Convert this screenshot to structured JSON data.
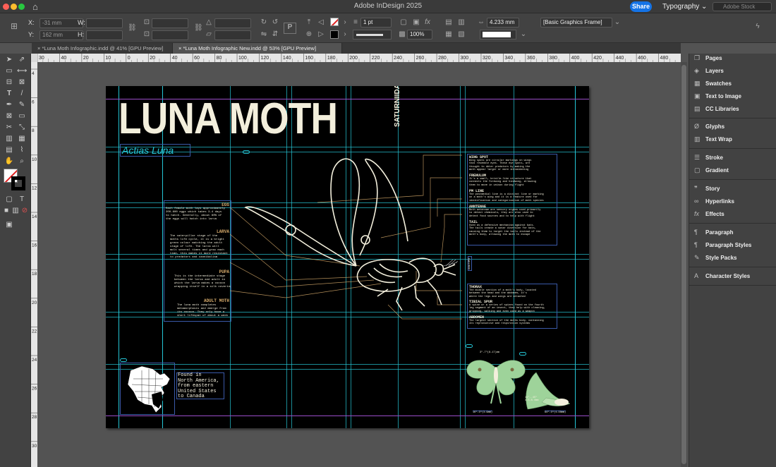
{
  "app": {
    "title": "Adobe InDesign 2025",
    "share_label": "Share",
    "workspace_label": "Typography",
    "stock_placeholder": "Adobe Stock"
  },
  "control_bar": {
    "x_label": "X:",
    "x_value": "-31 mm",
    "y_label": "Y:",
    "y_value": "162 mm",
    "w_label": "W:",
    "h_label": "H:",
    "stroke_weight": "1 pt",
    "opacity": "100%",
    "dimension": "4.233 mm",
    "object_style": "[Basic Graphics Frame]"
  },
  "tabs": [
    {
      "label": "*Luna Moth Infographic.indd @ 41% [GPU Preview]",
      "active": false
    },
    {
      "label": "*Luna Moth Infographic New.indd @ 53% [GPU Preview]",
      "active": true
    }
  ],
  "ruler": {
    "h_ticks": [
      "30",
      "40",
      "20",
      "10",
      "0",
      "20",
      "40",
      "60",
      "80",
      "100",
      "120",
      "140",
      "160",
      "180",
      "200",
      "220",
      "240",
      "260",
      "280",
      "300",
      "320",
      "340",
      "360",
      "380",
      "400",
      "420",
      "440",
      "460",
      "480"
    ],
    "v_ticks": [
      "4",
      "6",
      "8",
      "10",
      "12",
      "14",
      "16",
      "18",
      "20",
      "22",
      "24",
      "26",
      "28",
      "30"
    ]
  },
  "panels": [
    {
      "label": "Pages",
      "icon": "pages-icon"
    },
    {
      "label": "Layers",
      "icon": "layers-icon"
    },
    {
      "label": "Swatches",
      "icon": "swatches-icon"
    },
    {
      "label": "Text to Image",
      "icon": "text-to-image-icon"
    },
    {
      "label": "CC Libraries",
      "icon": "cc-libraries-icon"
    },
    {
      "label": "Glyphs",
      "icon": "glyphs-icon"
    },
    {
      "label": "Text Wrap",
      "icon": "text-wrap-icon"
    },
    {
      "label": "Stroke",
      "icon": "stroke-icon"
    },
    {
      "label": "Gradient",
      "icon": "gradient-icon"
    },
    {
      "label": "Story",
      "icon": "story-icon"
    },
    {
      "label": "Hyperlinks",
      "icon": "hyperlinks-icon"
    },
    {
      "label": "Effects",
      "icon": "effects-icon"
    },
    {
      "label": "Paragraph",
      "icon": "paragraph-icon"
    },
    {
      "label": "Paragraph Styles",
      "icon": "paragraph-styles-icon"
    },
    {
      "label": "Style Packs",
      "icon": "style-packs-icon"
    },
    {
      "label": "Character Styles",
      "icon": "character-styles-icon"
    }
  ],
  "document": {
    "title": "LUNA MOTH",
    "family": "SATURNIIDAE",
    "subtitle": "Actias Luna",
    "left_sections": [
      {
        "heading": "EGG",
        "body": "Each female moth lays approximately\n200-600 eggs which takes 3-4 days\nto hatch. Generally, about 80% of\nthe eggs will hatch into larva"
      },
      {
        "heading": "LARVA",
        "body": "The caterpillar stage of the\nmoths life cycle, it is a bright\ngreen colour matching the adult\nstage of life. The larva will\nmolt several times and grow each\ntime, this makes it more resistant\nto predators and cannibalism"
      },
      {
        "heading": "PUPA",
        "body": "This is the intermediate stage\nbetween the larva and adult in\nwhich the larva makes a cocoon\nwrapping itself in a silk covering"
      },
      {
        "heading": "ADULT MOTH",
        "body": "The luna moth completes\nmetamorphosis and emerge from\nits cocoon. They only have a\nshort lifespan of about a week"
      }
    ],
    "right_top_sections": [
      {
        "heading": "WING SPOT",
        "body": "Wing spots are circular markings on wings\nthat resemble eyes. These eye spots, are\nthought to deter predators by making the\nmoth appear larger or more intimidating"
      },
      {
        "heading": "FRENULUM",
        "body": "It's a small, bristle-like structure that\nconnects the forewing and hindwing, allowing\nthem to move in unison during flight"
      },
      {
        "heading": "PM LINE",
        "body": "The postmedial line is a distinct line or marking\non a moth's wing and it is a feature used for\nidentification and categorization of moth species"
      },
      {
        "heading": "ANNTENAE",
        "body": "Both antennae are sensory organs used primarily\nto detect chemicals, they are also used to\ndetect food sources and to help with flight"
      },
      {
        "heading": "TAIL",
        "body": "Used as a defensive mechanism against bats.\nThe tails create a sonar diversion for bats,\ncausing them to target the tails instead of the\nmoth's body, allowing the moth to escape"
      }
    ],
    "right_bottom_sections": [
      {
        "heading": "THORAX",
        "body": "The middle section of a moth's body, located\nbetween the head and the abdomen, it's\nwhere the legs and wings are attached"
      },
      {
        "heading": "TIBIAL SPUR",
        "body": "A spine or a series of spines found on the fourth\nleg segment of an insect, they help with cleaning,\ngripping, walking and even used as a weapon"
      },
      {
        "heading": "ABDOMEN",
        "body": "The largest section of the moths body, containing\nits reproductive and respiration systems"
      }
    ],
    "vertical_label": "ANATOMY",
    "range_text": "Found in\nNorth America,\nfrom eastern\nUnited States\nto Canada",
    "size_labels": [
      "3\"-7\"(8-17)mm",
      "16\"-3\"(3-9mm)",
      "11\"-.45\" 4.5-8.4mm",
      "94\"-3\"(4-38mm)"
    ],
    "colors": {
      "accent_orange": "#d4a96a",
      "guide_cyan": "#25c6d6",
      "text_cream": "#f3efdc",
      "moth_green": "#9ed39a"
    }
  }
}
